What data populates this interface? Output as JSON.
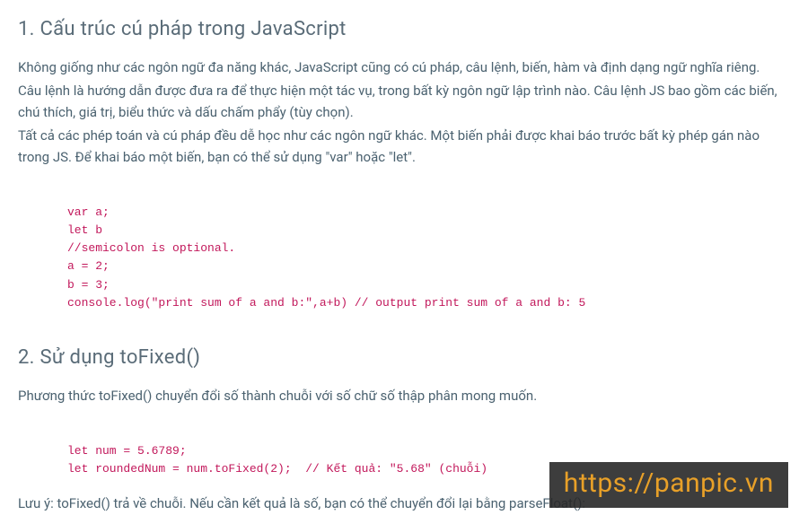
{
  "section1": {
    "heading": "1. Cấu trúc cú pháp trong JavaScript",
    "para1": "Không giống như các ngôn ngữ đa năng khác, JavaScript cũng có cú pháp, câu lệnh, biến, hàm và định dạng ngữ nghĩa riêng.",
    "para2": "Câu lệnh là hướng dẫn được đưa ra để thực hiện một tác vụ, trong bất kỳ ngôn ngữ lập trình nào. Câu lệnh JS bao gồm các biến, chú thích, giá trị, biểu thức và dấu chấm phẩy (tùy chọn).",
    "para3": "Tất cả các phép toán và cú pháp đều dễ học như các ngôn ngữ khác. Một biến phải được khai báo trước bất kỳ phép gán nào trong JS. Để khai báo một biến, bạn có thể sử dụng \"var\" hoặc \"let\".",
    "code": "var a;\nlet b\n//semicolon is optional.\na = 2;\nb = 3;\nconsole.log(\"print sum of a and b:\",a+b) // output print sum of a and b: 5"
  },
  "section2": {
    "heading": "2. Sử dụng toFixed()",
    "para1": "Phương thức toFixed() chuyển đổi số thành chuỗi với số chữ số thập phân mong muốn.",
    "code": "let num = 5.6789;\nlet roundedNum = num.toFixed(2);  // Kết quả: \"5.68\" (chuỗi)",
    "note": "Lưu ý: toFixed() trả về chuỗi. Nếu cần kết quả là số, bạn có thể chuyển đổi lại bằng parseFloat():"
  },
  "watermark": "https://panpic.vn"
}
